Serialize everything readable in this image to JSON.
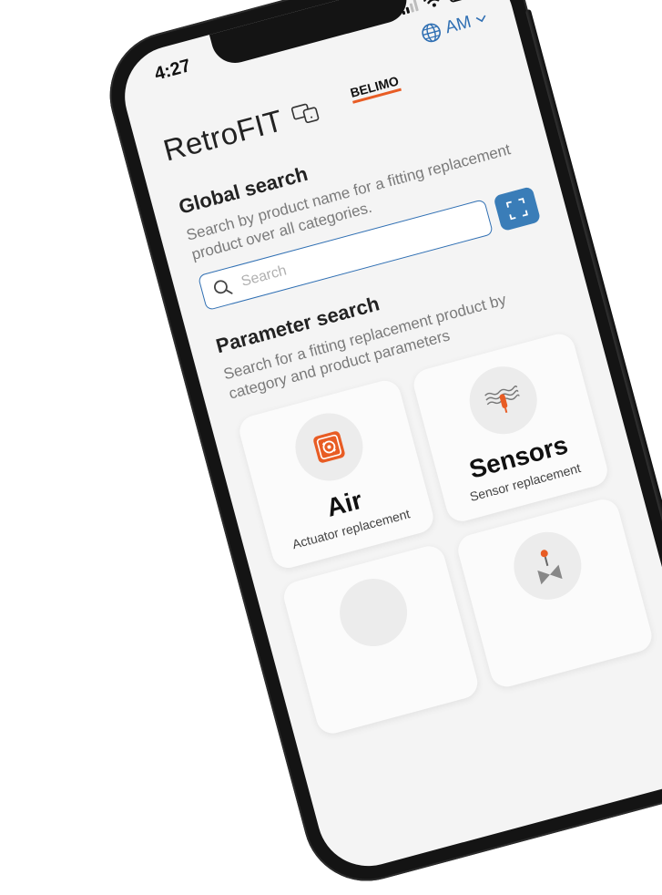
{
  "status": {
    "time": "4:27"
  },
  "language": {
    "label": "AM"
  },
  "app": {
    "title": "RetroFIT",
    "brand": "BELIMO"
  },
  "global_search": {
    "heading": "Global search",
    "description": "Search by product name for a fitting replacement product over all categories.",
    "placeholder": "Search"
  },
  "parameter_search": {
    "heading": "Parameter search",
    "description": "Search for a fitting replacement product by category and product parameters"
  },
  "categories": [
    {
      "title": "Air",
      "subtitle": "Actuator replacement",
      "icon": "actuator-icon"
    },
    {
      "title": "Sensors",
      "subtitle": "Sensor replacement",
      "icon": "sensor-icon"
    },
    {
      "title": "",
      "subtitle": "",
      "icon": ""
    },
    {
      "title": "",
      "subtitle": "",
      "icon": "valve-icon"
    }
  ],
  "colors": {
    "accent": "#2f6fb3",
    "button": "#3a7db8",
    "brand_orange": "#e85c24"
  }
}
